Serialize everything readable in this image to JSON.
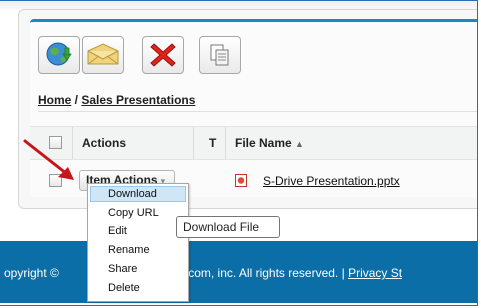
{
  "toolbar": {
    "buttons": [
      {
        "name": "download-globe-icon",
        "title": "Download"
      },
      {
        "name": "envelope-icon",
        "title": "Email"
      },
      {
        "name": "delete-icon",
        "title": "Delete"
      },
      {
        "name": "copy-icon",
        "title": "Copy"
      }
    ]
  },
  "breadcrumb": {
    "home": "Home",
    "separator": " / ",
    "current": "Sales Presentations"
  },
  "table": {
    "columns": [
      "Actions",
      "T",
      "File Name"
    ],
    "sort_indicator": "▲",
    "rows": [
      {
        "action_label": "Item Actions",
        "action_caret": "▾",
        "file_name": "S-Drive Presentation.pptx"
      }
    ]
  },
  "context_menu": {
    "items": [
      "Download",
      "Copy URL",
      "Edit",
      "Rename",
      "Share",
      "Delete"
    ],
    "active_index": 0
  },
  "tooltip": {
    "text": "Download File"
  },
  "footer": {
    "text_left": "opyright © ",
    "text_mid": "force.com, inc. All rights reserved. | ",
    "link": "Privacy St"
  },
  "colors": {
    "accent": "#1b87c9",
    "footer_bg": "#0b6ea6",
    "arrow": "#c8141b"
  }
}
